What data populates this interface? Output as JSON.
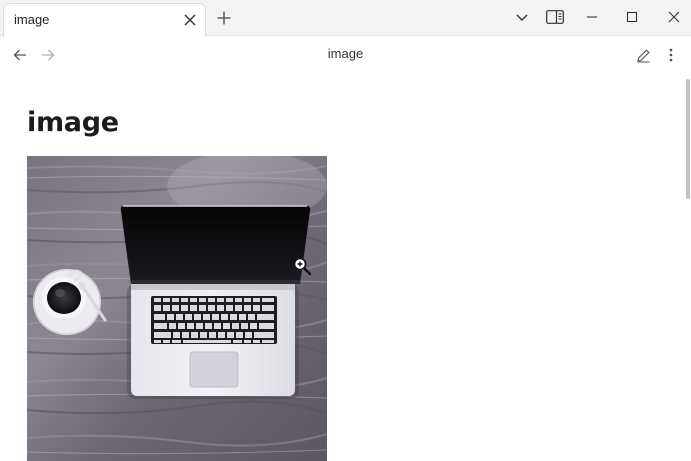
{
  "tab": {
    "title": "image"
  },
  "nav": {
    "title": "image"
  },
  "page": {
    "heading": "image"
  },
  "icons": {
    "tab_close": "close-icon",
    "new_tab": "plus-icon",
    "tab_list": "chevron-down-icon",
    "sidebar": "sidebar-icon",
    "minimize": "minimize-icon",
    "maximize": "maximize-icon",
    "close_window": "close-icon",
    "back": "arrow-left-icon",
    "forward": "arrow-right-icon",
    "edit": "pencil-icon",
    "more": "more-vertical-icon",
    "zoom_cursor": "zoom-in-cursor-icon"
  },
  "colors": {
    "titlebar_bg": "#f3f3f3",
    "page_bg": "#ffffff",
    "text": "#1c1c1c",
    "disabled_icon": "#b0b0b0"
  }
}
